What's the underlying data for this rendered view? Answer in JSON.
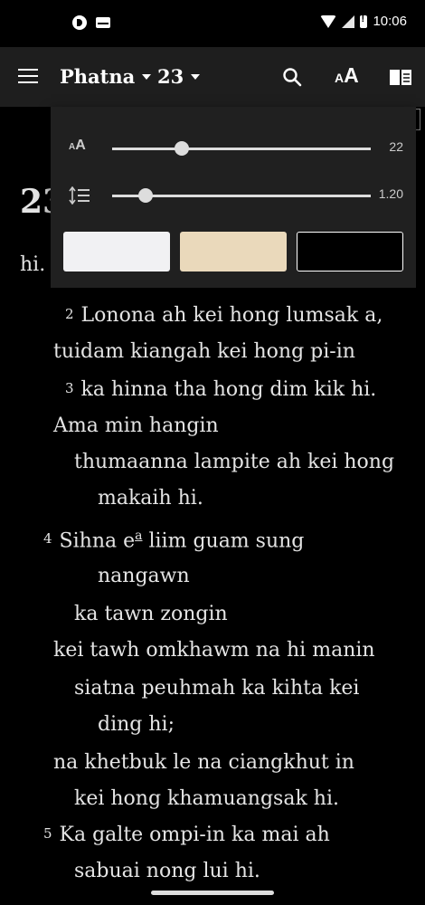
{
  "status_bar": {
    "time": "10:06",
    "icons": [
      "app-notification-icon",
      "mail-icon",
      "wifi-icon",
      "signal-icon",
      "battery-alert-icon"
    ]
  },
  "app_bar": {
    "book": "Phatna",
    "chapter": "23",
    "actions": [
      "search-icon",
      "text-size-icon",
      "book-view-icon"
    ]
  },
  "text_settings": {
    "font_size": {
      "icon": "AA",
      "value": "22",
      "level": 0.27
    },
    "line_spacing": {
      "icon": "line-spacing",
      "value": "1.20",
      "level": 0.13
    },
    "themes": [
      {
        "name": "light",
        "color": "#f1f1f3"
      },
      {
        "name": "sepia",
        "color": "#ead9bb"
      },
      {
        "name": "dark",
        "color": "#000000"
      }
    ]
  },
  "reading": {
    "chapter_number": "23",
    "lines": [
      {
        "text": "hi."
      },
      {
        "verse": "2",
        "text": "Lonona ah kei hong lumsak a,"
      },
      {
        "text": "tuidam kiangah kei hong pi-in"
      },
      {
        "verse": "3",
        "text": "ka hinna tha hong dim kik hi."
      },
      {
        "text": "Ama min hangin"
      },
      {
        "text": "thumaanna lampite ah kei hong"
      },
      {
        "text": "makaih hi."
      },
      {
        "verse": "4",
        "text_before": "Sihna e",
        "footnote": "a",
        "text_after": " liim guam sung"
      },
      {
        "text": "nangawn"
      },
      {
        "text": "ka tawn zongin"
      },
      {
        "text": "kei tawh omkhawm na hi manin"
      },
      {
        "text": "siatna peuhmah ka kihta kei"
      },
      {
        "text": "ding hi;"
      },
      {
        "text": "na khetbuk le na ciangkhut in"
      },
      {
        "text": "kei hong khamuangsak hi."
      },
      {
        "verse": "5",
        "text": "Ka galte ompi-in ka mai ah"
      },
      {
        "text": "sabuai nong lui hi."
      }
    ]
  }
}
